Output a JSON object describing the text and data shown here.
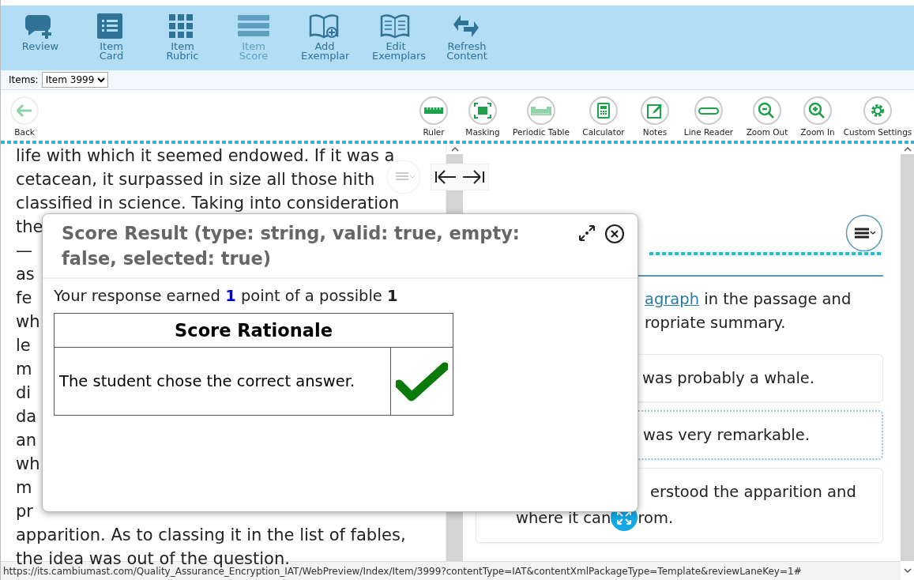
{
  "ribbon": {
    "buttons": [
      {
        "label": "Review",
        "disabled": false
      },
      {
        "label": "Item Card",
        "disabled": false
      },
      {
        "label": "Item Rubric",
        "disabled": false
      },
      {
        "label": "Item Score",
        "disabled": true
      },
      {
        "label": "Add Exemplar",
        "disabled": false
      },
      {
        "label": "Edit Exemplars",
        "disabled": false
      },
      {
        "label": "Refresh Content",
        "disabled": false
      }
    ]
  },
  "items_selector": {
    "label": "Items:",
    "value": "Item 3999"
  },
  "toolbar": {
    "back": "Back",
    "tools": [
      "Ruler",
      "Masking",
      "Periodic Table",
      "Calculator",
      "Notes",
      "Line Reader",
      "Zoom Out",
      "Zoom In",
      "Custom Settings"
    ]
  },
  "passage": {
    "lines": [
      "life with which it seemed endowed. If it was a",
      "cetacean, it surpassed in size all those hith",
      "classified in science. Taking into consideration",
      "the",
      "—",
      "as",
      "fe",
      "wh",
      "le",
      "m",
      "di",
      "da",
      "an",
      "wh",
      "m",
      "pr",
      "apparition. As to classing it in the list of fables,",
      "the idea was out of the question."
    ]
  },
  "item": {
    "prompt": [
      {
        "link": "agraph",
        "text": " in the passage and"
      },
      {
        "text": "ropriate summary."
      }
    ],
    "options": [
      {
        "lines": [
          [
            "was probably a whale."
          ]
        ],
        "focused": false
      },
      {
        "lines": [
          [
            "was very remarkable."
          ]
        ],
        "focused": true
      },
      {
        "lines": [
          [
            "erstood the apparition and"
          ],
          [
            "where it can",
            "rom."
          ]
        ],
        "focused": false
      }
    ]
  },
  "score_dialog": {
    "title": "Score Result (type: string, valid: true, empty: false, selected: true)",
    "summary": {
      "before": "Your response earned ",
      "earned": "1",
      "middle": " point of a possible ",
      "possible": "1"
    },
    "table": {
      "heading": "Score Rationale",
      "rationale": "The student chose the correct answer.",
      "correct": true
    }
  },
  "status_bar": {
    "url": "https://its.cambiumast.com/Quality_Assurance_Encryption_IAT/WebPreview/Index/Item/3999?contentType=IAT&contentXmlPackageType=Template&reviewLaneKey=1#"
  }
}
